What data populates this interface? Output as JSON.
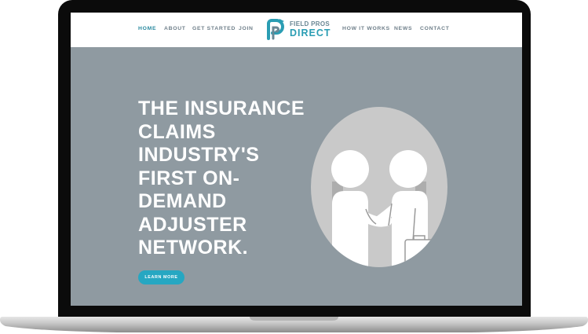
{
  "nav": {
    "left_items": [
      {
        "label": "HOME",
        "active": true
      },
      {
        "label": "ABOUT",
        "active": false
      },
      {
        "label": "GET STARTED",
        "active": false
      },
      {
        "label": "JOIN",
        "active": false
      }
    ],
    "right_items": [
      {
        "label": "HOW IT WORKS",
        "active": false
      },
      {
        "label": "NEWS",
        "active": false
      },
      {
        "label": "CONTACT",
        "active": false
      }
    ]
  },
  "logo": {
    "line1": "FIELD PROS",
    "line2": "DIRECT"
  },
  "hero": {
    "title_lines": [
      "THE INSURANCE",
      "CLAIMS",
      "INDUSTRY'S",
      "FIRST ON-",
      "DEMAND",
      "ADJUSTER",
      "NETWORK."
    ],
    "cta_label": "LEARN MORE",
    "illustration": "handshake-icon"
  },
  "colors": {
    "hero_background": "#8f9aa1",
    "accent": "#26a7c2",
    "nav_active": "#2a8aa0",
    "nav_text": "#6f7f8a",
    "bezel": "#0b0b0b"
  }
}
